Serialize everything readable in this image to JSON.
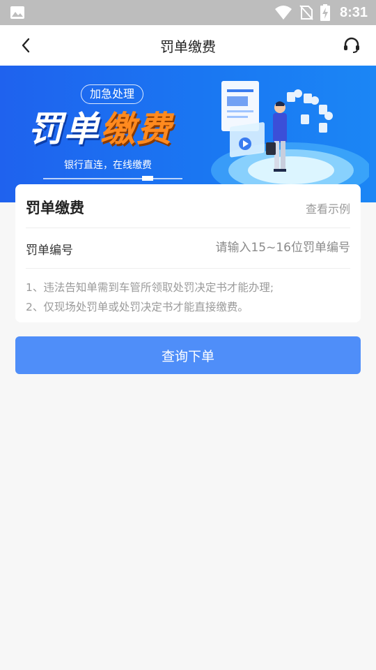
{
  "status_bar": {
    "time": "8:31",
    "icons": [
      "image-icon",
      "wifi-icon",
      "no-sim-icon",
      "battery-charging-icon"
    ]
  },
  "nav": {
    "title": "罚单缴费",
    "back_icon": "chevron-left-icon",
    "service_icon": "headset-icon"
  },
  "banner": {
    "tag": "加急处理",
    "headline_white": "罚单",
    "headline_orange": "缴费",
    "subtitle": "银行直连，在线缴费"
  },
  "card": {
    "title": "罚单缴费",
    "example_link": "查看示例",
    "field_label": "罚单编号",
    "field_placeholder": "请输入15~16位罚单编号",
    "field_value": "",
    "notes": [
      "1、违法告知单需到车管所领取处罚决定书才能办理;",
      "2、仅现场处罚单或处罚决定书才能直接缴费。"
    ]
  },
  "submit_button": "查询下单",
  "colors": {
    "primary": "#4f8ef9",
    "banner_blue": "#1a6ef0",
    "accent_orange": "#ff8a1f",
    "page_bg": "#f7f7f7"
  }
}
